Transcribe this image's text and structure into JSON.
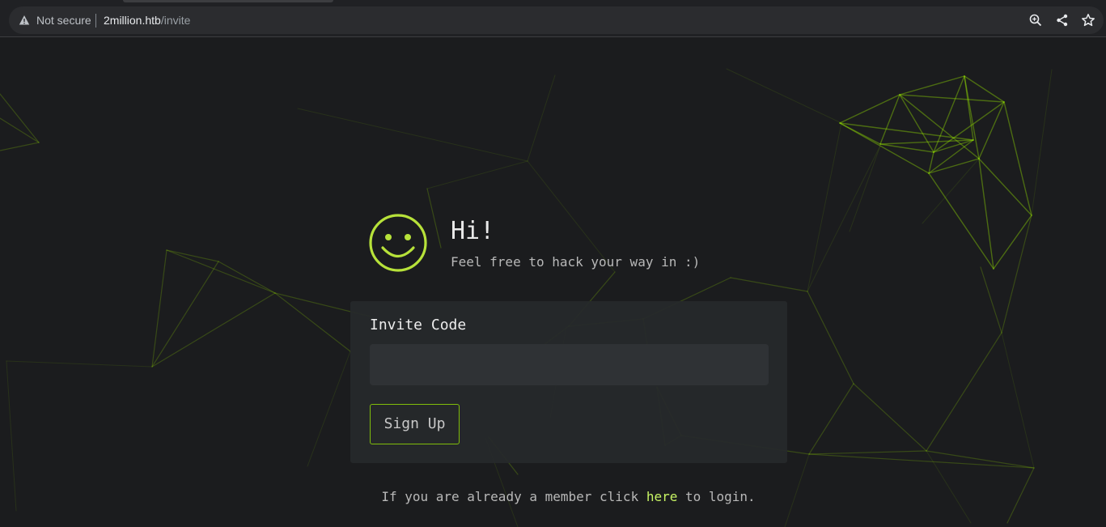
{
  "browser": {
    "security_label": "Not secure",
    "url_host": "2million.htb",
    "url_path": "/invite",
    "icons": [
      "warning-icon",
      "zoom-icon",
      "share-icon",
      "bookmark-star-icon"
    ]
  },
  "page": {
    "hero_icon": "smiley-icon",
    "greeting": "Hi!",
    "subtitle": "Feel free to hack your way in :)",
    "form": {
      "invite_label": "Invite Code",
      "invite_value": "",
      "invite_placeholder": "",
      "submit_label": "Sign Up"
    },
    "footer": {
      "before": "If you are already a member click ",
      "link": "here",
      "after": " to login."
    }
  },
  "colors": {
    "accent": "#9fef00",
    "link": "#c7f464",
    "background": "#1b1c1e",
    "card": "#26292b"
  }
}
